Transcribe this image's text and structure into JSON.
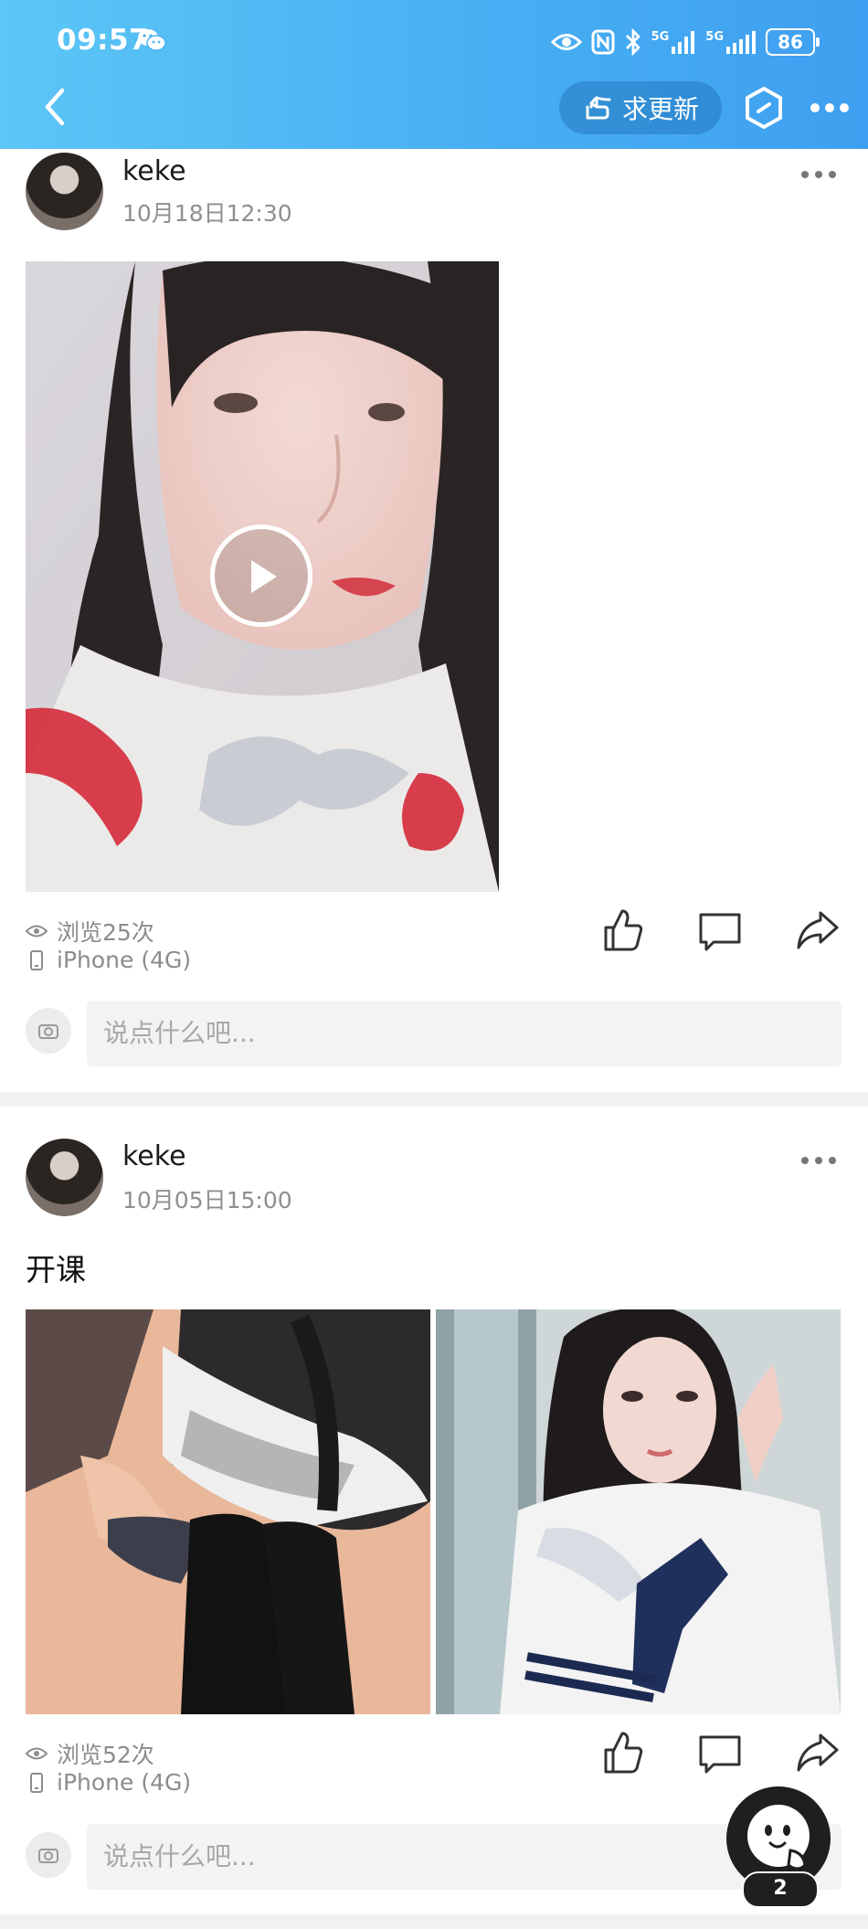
{
  "status_bar": {
    "time": "09:57",
    "signal_label_1": "5G",
    "signal_label_2": "5G",
    "battery": "86"
  },
  "header": {
    "request_update_label": "求更新",
    "icons": [
      "back-arrow-icon",
      "pointing-hand-icon",
      "hexagon-icon",
      "more-dots-icon"
    ],
    "bg_color": "#47b0f3"
  },
  "posts": [
    {
      "username": "keke",
      "time": "10月18日12:30",
      "caption": "",
      "media_type": "video",
      "views": "浏览25次",
      "device": "iPhone (4G)",
      "comment_placeholder": "说点什么吧..."
    },
    {
      "username": "keke",
      "time": "10月05日15:00",
      "caption": "开课",
      "media_type": "photos",
      "photo_count": 2,
      "views": "浏览52次",
      "device": "iPhone (4G)",
      "comment_placeholder": "说点什么吧..."
    }
  ],
  "floating_button": {
    "badge": "2"
  }
}
